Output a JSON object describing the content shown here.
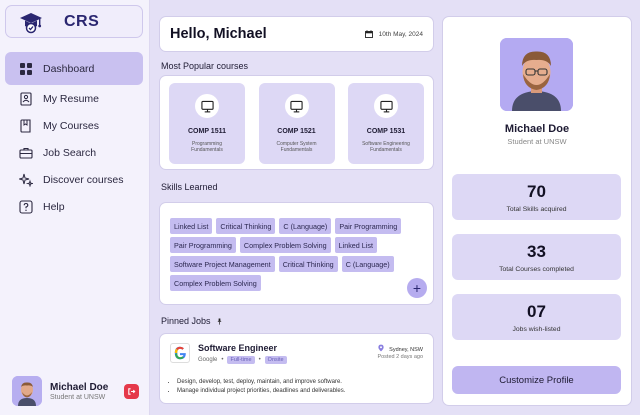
{
  "app": {
    "logo_text": "CRS"
  },
  "sidebar": {
    "items": [
      {
        "label": "Dashboard",
        "icon": "grid-icon",
        "active": true
      },
      {
        "label": "My Resume",
        "icon": "resume-icon",
        "active": false
      },
      {
        "label": "My Courses",
        "icon": "book-icon",
        "active": false
      },
      {
        "label": "Job Search",
        "icon": "briefcase-icon",
        "active": false
      },
      {
        "label": "Discover courses",
        "icon": "sparkle-icon",
        "active": false
      },
      {
        "label": "Help",
        "icon": "question-icon",
        "active": false
      }
    ],
    "user": {
      "name": "Michael Doe",
      "role": "Student at UNSW"
    }
  },
  "header": {
    "greeting": "Hello, Michael",
    "date": "10th May, 2024"
  },
  "popular": {
    "title": "Most Popular courses",
    "courses": [
      {
        "code": "COMP 1511",
        "name": "Programming Fundamentals"
      },
      {
        "code": "COMP 1521",
        "name": "Computer System Fundamentals"
      },
      {
        "code": "COMP 1531",
        "name": "Software Engineering Fundamentals"
      }
    ]
  },
  "skills": {
    "title": "Skills Learned",
    "chips": [
      "Linked List",
      "Critical Thinking",
      "C (Language)",
      "Pair Programming",
      "Pair Programming",
      "Complex Problem Solving",
      "Linked List",
      "Software Project Management",
      "Critical Thinking",
      "C (Language)",
      "Complex Problem Solving"
    ],
    "add_label": "+"
  },
  "pinned": {
    "title": "Pinned Jobs",
    "job": {
      "title": "Software Engineer",
      "company": "Google",
      "tags": [
        "Full-time",
        "Onsite"
      ],
      "location": "Sydney, NSW",
      "posted": "Posted 2 days ago",
      "bullets": [
        "Design, develop, test, deploy, maintain, and improve software.",
        "Manage individual project priorities, deadlines and deliverables."
      ]
    }
  },
  "profile": {
    "name": "Michael Doe",
    "role": "Student at UNSW",
    "stats": [
      {
        "value": "70",
        "label": "Total Skills acquired"
      },
      {
        "value": "33",
        "label": "Total Courses completed"
      },
      {
        "value": "07",
        "label": "Jobs wish-listed"
      }
    ],
    "customize_label": "Customize Profile"
  },
  "colors": {
    "accent": "#c9c1f0",
    "brand": "#2a2670",
    "logout": "#e5394a"
  }
}
